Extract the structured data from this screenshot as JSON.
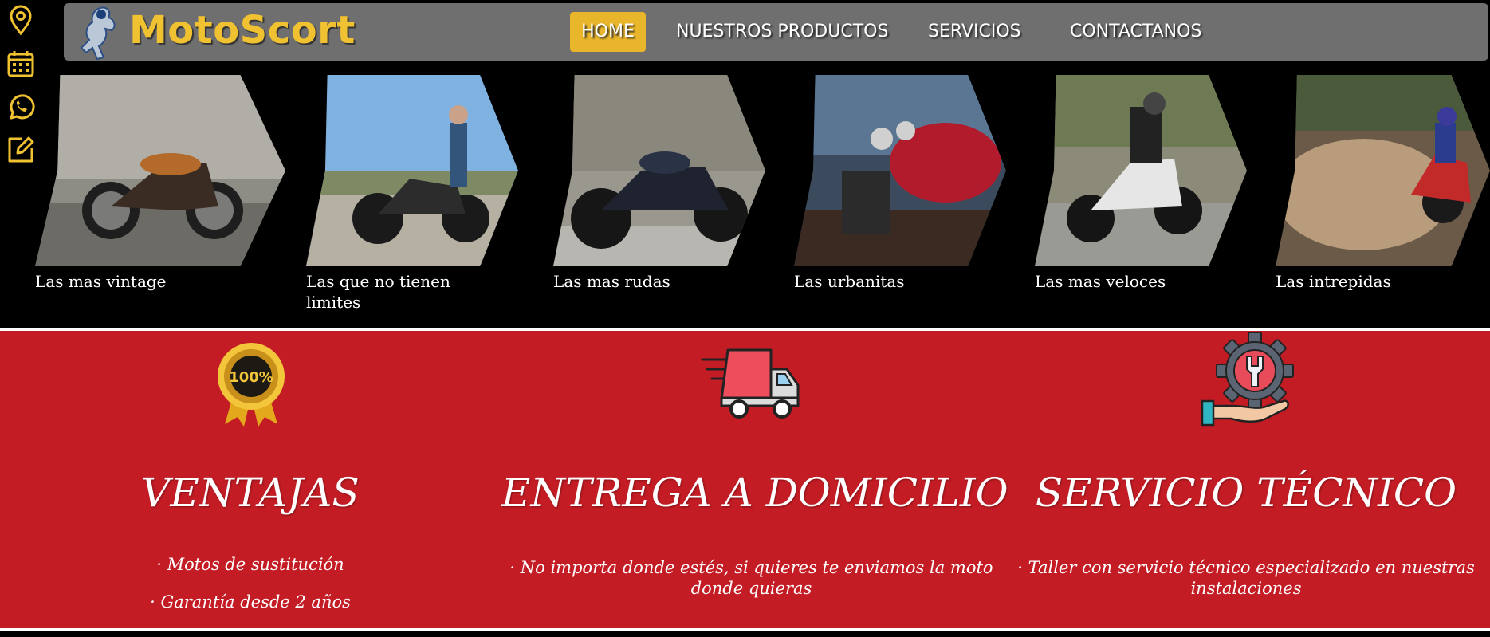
{
  "header": {
    "brand": "MotoScort",
    "nav": [
      {
        "label": "HOME",
        "active": true
      },
      {
        "label": "NUESTROS PRODUCTOS",
        "active": false
      },
      {
        "label": "SERVICIOS",
        "active": false
      },
      {
        "label": "CONTACTANOS",
        "active": false
      }
    ]
  },
  "side_icons": [
    "location-pin-icon",
    "calendar-icon",
    "whatsapp-icon",
    "edit-icon"
  ],
  "gallery": [
    {
      "label": "Las mas vintage"
    },
    {
      "label": "Las que no tienen limites"
    },
    {
      "label": "Las mas rudas"
    },
    {
      "label": "Las urbanitas"
    },
    {
      "label": "Las mas veloces"
    },
    {
      "label": "Las intrepidas"
    }
  ],
  "features": [
    {
      "title": "VENTAJAS",
      "lines": [
        "· Motos de sustitución",
        "· Garantía desde 2 años"
      ],
      "icon": "guarantee-badge-icon"
    },
    {
      "title": "ENTREGA A DOMICILIO",
      "lines": [
        "· No importa donde estés, si quieres te enviamos la moto donde quieras"
      ],
      "icon": "delivery-truck-icon"
    },
    {
      "title": "SERVICIO TÉCNICO",
      "lines": [
        "· Taller con servicio técnico especializado en nuestras instalaciones"
      ],
      "icon": "gear-wrench-icon"
    }
  ],
  "colors": {
    "accent": "#f0c231",
    "header_bg": "#6f6f6f",
    "nav_active": "#e9b52a",
    "features_bg": "#c41c24"
  }
}
